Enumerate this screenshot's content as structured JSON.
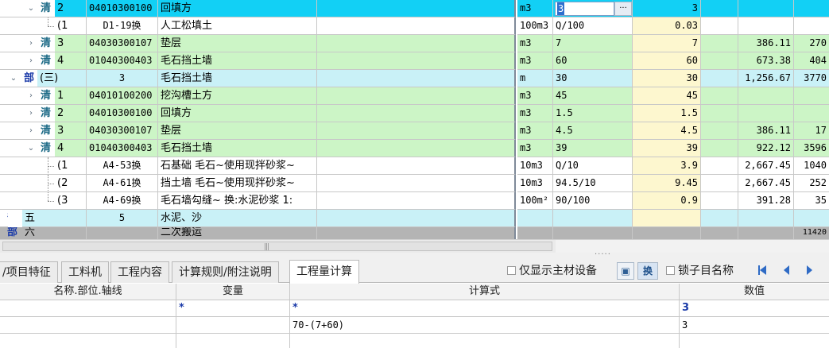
{
  "grid": {
    "rows": [
      {
        "type": "清",
        "seq": "2",
        "code": "04010300100",
        "name": "回填方",
        "feature": "",
        "unit": "m3",
        "expr": "3",
        "qty": "3",
        "price": "",
        "total": ""
      },
      {
        "type": "子",
        "seq": "(1",
        "code": "D1-19换",
        "name": "人工松填土",
        "feature": "",
        "unit": "100m3",
        "expr": "Q/100",
        "qty": "0.03",
        "price": "",
        "total": ""
      },
      {
        "type": "清",
        "seq": "3",
        "code": "04030300107",
        "name": "垫层",
        "feature": "",
        "unit": "m3",
        "expr": "7",
        "qty": "7",
        "price": "386.11",
        "total": "270"
      },
      {
        "type": "清",
        "seq": "4",
        "code": "01040300403",
        "name": "毛石挡土墙",
        "feature": "",
        "unit": "m3",
        "expr": "60",
        "qty": "60",
        "price": "673.38",
        "total": "404"
      },
      {
        "type": "部",
        "seq": "(三)",
        "code": "3",
        "name": "毛石挡土墙",
        "feature": "",
        "unit": "m",
        "expr": "30",
        "qty": "30",
        "price": "1,256.67",
        "total": "3770"
      },
      {
        "type": "清",
        "seq": "1",
        "code": "04010100200",
        "name": "挖沟槽土方",
        "feature": "",
        "unit": "m3",
        "expr": "45",
        "qty": "45",
        "price": "",
        "total": ""
      },
      {
        "type": "清",
        "seq": "2",
        "code": "04010300100",
        "name": "回填方",
        "feature": "",
        "unit": "m3",
        "expr": "1.5",
        "qty": "1.5",
        "price": "",
        "total": ""
      },
      {
        "type": "清",
        "seq": "3",
        "code": "04030300107",
        "name": "垫层",
        "feature": "",
        "unit": "m3",
        "expr": "4.5",
        "qty": "4.5",
        "price": "386.11",
        "total": "17"
      },
      {
        "type": "清",
        "seq": "4",
        "code": "01040300403",
        "name": "毛石挡土墙",
        "feature": "",
        "unit": "m3",
        "expr": "39",
        "qty": "39",
        "price": "922.12",
        "total": "3596"
      },
      {
        "type": "子",
        "seq": "(1",
        "code": "A4-53换",
        "name": "石基础 毛石~使用现拌砂浆~",
        "feature": "",
        "unit": "10m3",
        "expr": "Q/10",
        "qty": "3.9",
        "price": "2,667.45",
        "total": "1040"
      },
      {
        "type": "子",
        "seq": "(2",
        "code": "A4-61换",
        "name": "挡土墙 毛石~使用现拌砂浆~",
        "feature": "",
        "unit": "10m3",
        "expr": "94.5/10",
        "qty": "9.45",
        "price": "2,667.45",
        "total": "252"
      },
      {
        "type": "子",
        "seq": "(3",
        "code": "A4-69换",
        "name": "毛石墙勾缝~ 换:水泥砂浆 1:",
        "feature": "",
        "unit": "100m²",
        "expr": "90/100",
        "qty": "0.9",
        "price": "391.28",
        "total": "35"
      },
      {
        "type": "部",
        "seq": "五",
        "code": "5",
        "name": "水泥、沙",
        "feature": "",
        "unit": "",
        "expr": "",
        "qty": "",
        "price": "",
        "total": ""
      },
      {
        "type": "部",
        "seq": "六",
        "code": "",
        "name": "二次搬运",
        "feature": "",
        "unit": "",
        "expr": "",
        "qty": "",
        "price": "",
        "total": "11420"
      }
    ],
    "edit_value": "3",
    "edit_button": "···"
  },
  "tabs": [
    "/项目特征",
    "工料机",
    "工程内容",
    "计算规则/附注说明",
    "工程量计算"
  ],
  "toolbar": {
    "show_main_label": "仅显示主材设备",
    "swap_label": "换",
    "lock_label": "锁子目名称"
  },
  "lower": {
    "headers": [
      "名称.部位.轴线",
      "变量",
      "计算式",
      "数值"
    ],
    "rows": [
      [
        "",
        "*",
        "*",
        "3"
      ],
      [
        "",
        "",
        "70-(7+60)",
        "3"
      ]
    ]
  }
}
